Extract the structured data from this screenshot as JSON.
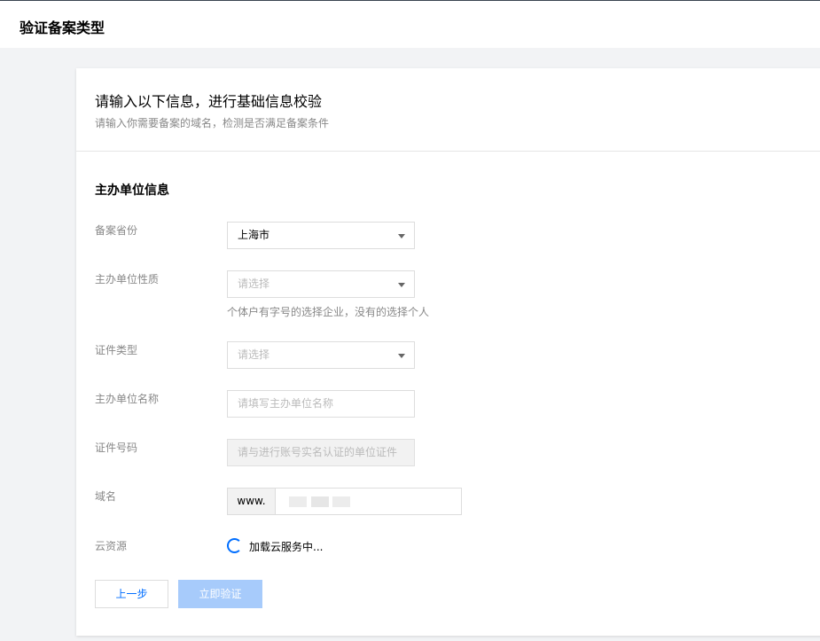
{
  "header": {
    "title": "验证备案类型"
  },
  "card": {
    "title": "请输入以下信息，进行基础信息校验",
    "subtitle": "请输入你需要备案的域名，检测是否满足备案条件"
  },
  "section": {
    "title": "主办单位信息"
  },
  "fields": {
    "province": {
      "label": "备案省份",
      "value": "上海市"
    },
    "org_type": {
      "label": "主办单位性质",
      "placeholder": "请选择",
      "hint": "个体户有字号的选择企业，没有的选择个人"
    },
    "cert_type": {
      "label": "证件类型",
      "placeholder": "请选择"
    },
    "org_name": {
      "label": "主办单位名称",
      "placeholder": "请填写主办单位名称"
    },
    "cert_number": {
      "label": "证件号码",
      "placeholder": "请与进行账号实名认证的单位证件"
    },
    "domain": {
      "label": "域名",
      "prefix": "www."
    },
    "cloud_resource": {
      "label": "云资源",
      "status": "加载云服务中..."
    }
  },
  "buttons": {
    "prev": "上一步",
    "verify": "立即验证"
  },
  "colors": {
    "accent": "#006eff",
    "disabled_button": "#a7cbfb"
  }
}
